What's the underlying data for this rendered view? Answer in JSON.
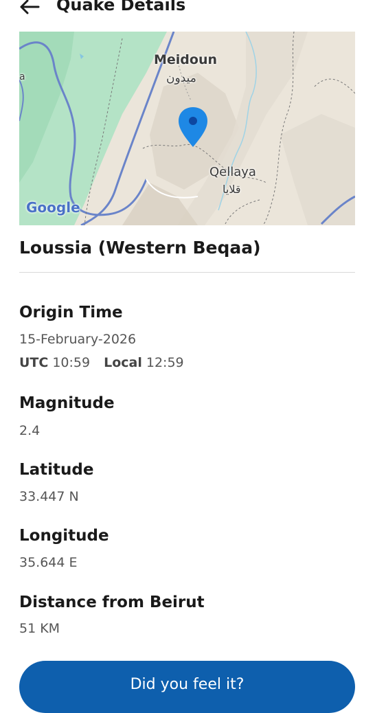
{
  "header": {
    "title": "Quake Details",
    "back_icon": "arrow-left-icon"
  },
  "map": {
    "labels": {
      "meidoun": "Meidoun",
      "meidoun_ar": "ميدون",
      "qellaya": "Qellaya",
      "qellaya_ar": "قلايا",
      "edge_letter": "a"
    },
    "google_logo": "Google",
    "marker_icon": "map-pin-icon",
    "marker_color": "#1e88e5"
  },
  "location": {
    "name": "Loussia (Western Beqaa)"
  },
  "origin_time": {
    "label": "Origin Time",
    "date": "15-February-2026",
    "utc_label": "UTC",
    "utc_value": "10:59",
    "local_label": "Local",
    "local_value": "12:59"
  },
  "magnitude": {
    "label": "Magnitude",
    "value": "2.4"
  },
  "latitude": {
    "label": "Latitude",
    "value": "33.447 N"
  },
  "longitude": {
    "label": "Longitude",
    "value": "35.644 E"
  },
  "distance": {
    "label": "Distance from Beirut",
    "value": "51 KM"
  },
  "actions": {
    "feel_button": "Did you feel it?"
  },
  "colors": {
    "accent": "#0e5fad",
    "map_green": "#a8dfc0",
    "road": "#6a84c9"
  }
}
